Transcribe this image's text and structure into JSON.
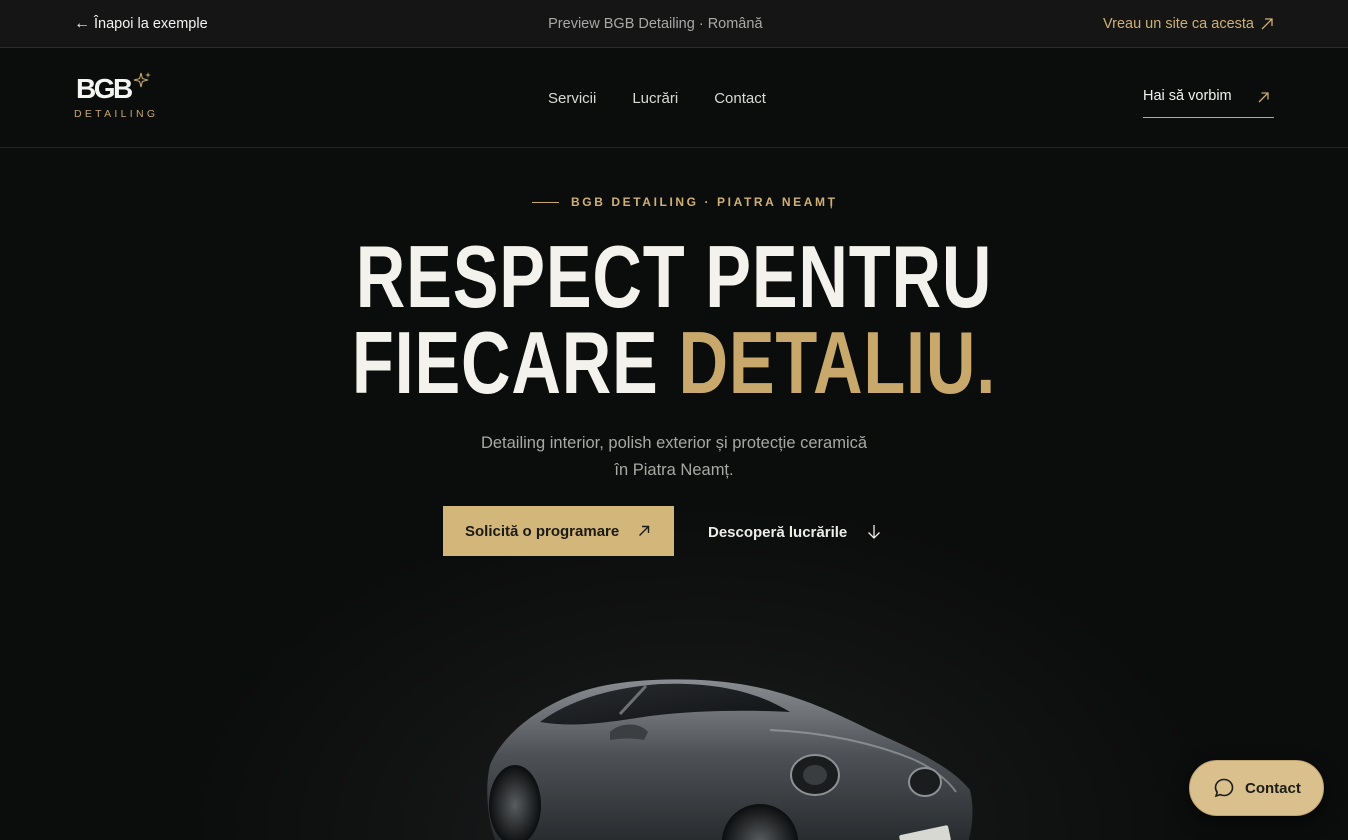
{
  "topbar": {
    "back_arrow": "←",
    "back_label": "Înapoi la exemple",
    "preview_label": "Preview BGB Detailing · Română",
    "cta_label": "Vreau un site ca acesta"
  },
  "logo": {
    "wordmark": "BGB",
    "subtitle": "DETAILING"
  },
  "nav": {
    "items": [
      "Servicii",
      "Lucrări",
      "Contact"
    ],
    "talk_label": "Hai să vorbim"
  },
  "hero": {
    "eyebrow": "BGB DETAILING · PIATRA NEAMȚ",
    "headline_line1": "RESPECT PENTRU",
    "headline_line2_white": "FIECARE ",
    "headline_line2_gold": "DETALIU.",
    "description_line1": "Detailing interior, polish exterior și protecție ceramică",
    "description_line2": "în Piatra Neamț.",
    "primary_button": "Solicită o programare",
    "secondary_button": "Descoperă lucrările"
  },
  "chat": {
    "label": "Contact"
  },
  "colors": {
    "background": "#0b0c0c",
    "accent_gold": "#c8a96b",
    "button_gold": "#d3b77a",
    "text": "#f3f2ec"
  },
  "icons": [
    "arrow-left-icon",
    "arrow-up-right-icon",
    "sparkle-icon",
    "arrow-down-icon",
    "chat-bubble-icon"
  ]
}
